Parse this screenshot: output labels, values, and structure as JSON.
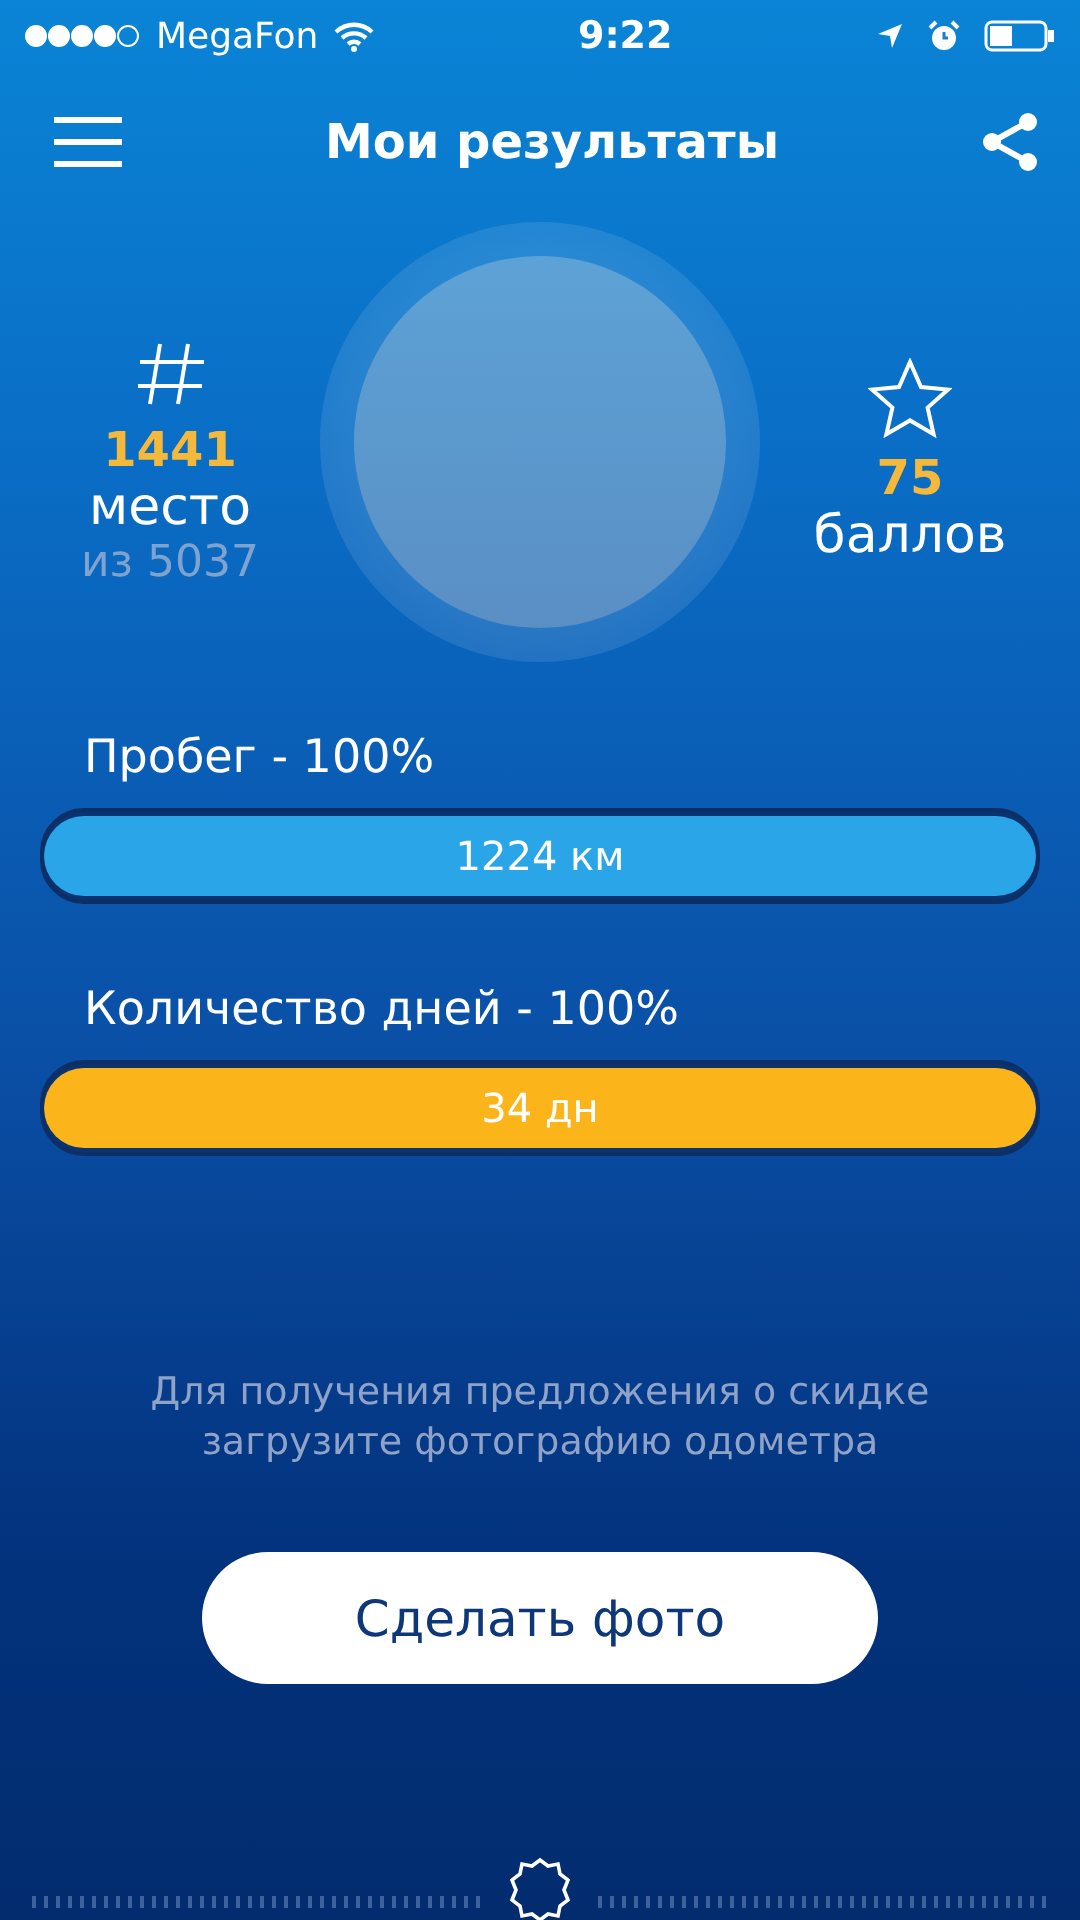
{
  "status_bar": {
    "carrier": "MegaFon",
    "time": "9:22"
  },
  "nav": {
    "title": "Мои результаты"
  },
  "stats": [
    {
      "kind": "rank",
      "value": "1441",
      "label": "место",
      "sub": "из  5037"
    },
    {
      "kind": "points",
      "value": "75",
      "label": "баллов"
    }
  ],
  "progress": [
    {
      "label": "Пробег - 100%",
      "level": 1.0,
      "reading": "1224 км",
      "color": "#2aa5e8"
    },
    {
      "label": "Количество дней - 100%",
      "level": 1.0,
      "reading": "34 дн",
      "color": "#fbb41a"
    }
  ],
  "hint": "Для получения предложения о скидке загрузите фотографию одометра",
  "button": "Сделать фото"
}
